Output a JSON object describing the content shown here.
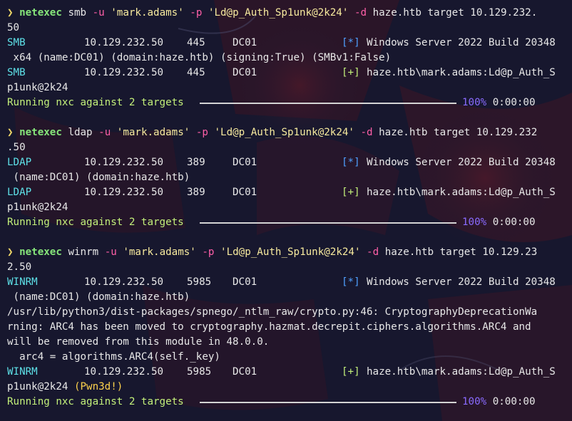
{
  "colors": {
    "background": "#1a1a32",
    "prompt": "#f0d868",
    "command": "#86e57a",
    "flag": "#ff5fa8",
    "string": "#f7ea9e",
    "protocol": "#5ee1e8",
    "info_marker": "#4fa0ff",
    "success_marker": "#c3f07a",
    "percent": "#8a6bff",
    "pwned": "#ffd34d"
  },
  "blocks": [
    {
      "cmd_lines": [
        {
          "prompt": "❯",
          "cmd": "netexec",
          "proto": "smb",
          "f_u": "-u",
          "user": "'mark.adams'",
          "f_p": "-p",
          "pass": "'Ld@p_Auth_Sp1unk@2k24'",
          "f_d": "-d",
          "domain": "haze.htb",
          "target_kw": "target",
          "ip_head": "10.129.232.",
          "ip_tail": "50"
        }
      ],
      "rows": [
        {
          "proto": "SMB",
          "ip": "10.129.232.50",
          "port": "445",
          "host": "DC01",
          "marker": "[*]",
          "text": "Windows Server 2022 Build 20348",
          "wrap": " x64 (name:DC01) (domain:haze.htb) (signing:True) (SMBv1:False)"
        },
        {
          "proto": "SMB",
          "ip": "10.129.232.50",
          "port": "445",
          "host": "DC01",
          "marker": "[+]",
          "text": "haze.htb\\mark.adams:Ld@p_Auth_S",
          "wrap": "p1unk@2k24"
        }
      ],
      "progress": {
        "label": "Running nxc against 2 targets",
        "percent": "100%",
        "time": "0:00:00"
      }
    },
    {
      "cmd_lines": [
        {
          "prompt": "❯",
          "cmd": "netexec",
          "proto": "ldap",
          "f_u": "-u",
          "user": "'mark.adams'",
          "f_p": "-p",
          "pass": "'Ld@p_Auth_Sp1unk@2k24'",
          "f_d": "-d",
          "domain": "haze.htb",
          "target_kw": "target",
          "ip_head": "10.129.232",
          "ip_tail": ".50"
        }
      ],
      "rows": [
        {
          "proto": "LDAP",
          "ip": "10.129.232.50",
          "port": "389",
          "host": "DC01",
          "marker": "[*]",
          "text": "Windows Server 2022 Build 20348",
          "wrap": " (name:DC01) (domain:haze.htb)"
        },
        {
          "proto": "LDAP",
          "ip": "10.129.232.50",
          "port": "389",
          "host": "DC01",
          "marker": "[+]",
          "text": "haze.htb\\mark.adams:Ld@p_Auth_S",
          "wrap": "p1unk@2k24"
        }
      ],
      "progress": {
        "label": "Running nxc against 2 targets",
        "percent": "100%",
        "time": "0:00:00"
      }
    },
    {
      "cmd_lines": [
        {
          "prompt": "❯",
          "cmd": "netexec",
          "proto": "winrm",
          "f_u": "-u",
          "user": "'mark.adams'",
          "f_p": "-p",
          "pass": "'Ld@p_Auth_Sp1unk@2k24'",
          "f_d": "-d",
          "domain": "haze.htb",
          "target_kw": "target",
          "ip_head": "10.129.23",
          "ip_tail": "2.50"
        }
      ],
      "rows": [
        {
          "proto": "WINRM",
          "ip": "10.129.232.50",
          "port": "5985",
          "host": "DC01",
          "marker": "[*]",
          "text": "Windows Server 2022 Build 20348",
          "wrap": " (name:DC01) (domain:haze.htb)"
        }
      ],
      "warning": [
        "/usr/lib/python3/dist-packages/spnego/_ntlm_raw/crypto.py:46: CryptographyDeprecationWa",
        "rning: ARC4 has been moved to cryptography.hazmat.decrepit.ciphers.algorithms.ARC4 and",
        "will be removed from this module in 48.0.0.",
        "  arc4 = algorithms.ARC4(self._key)"
      ],
      "success_row": {
        "proto": "WINRM",
        "ip": "10.129.232.50",
        "port": "5985",
        "host": "DC01",
        "marker": "[+]",
        "text": "haze.htb\\mark.adams:Ld@p_Auth_S",
        "wrap": "p1unk@2k24",
        "pwned": "(Pwn3d!)"
      },
      "progress": {
        "label": "Running nxc against 2 targets",
        "percent": "100%",
        "time": "0:00:00"
      }
    }
  ]
}
